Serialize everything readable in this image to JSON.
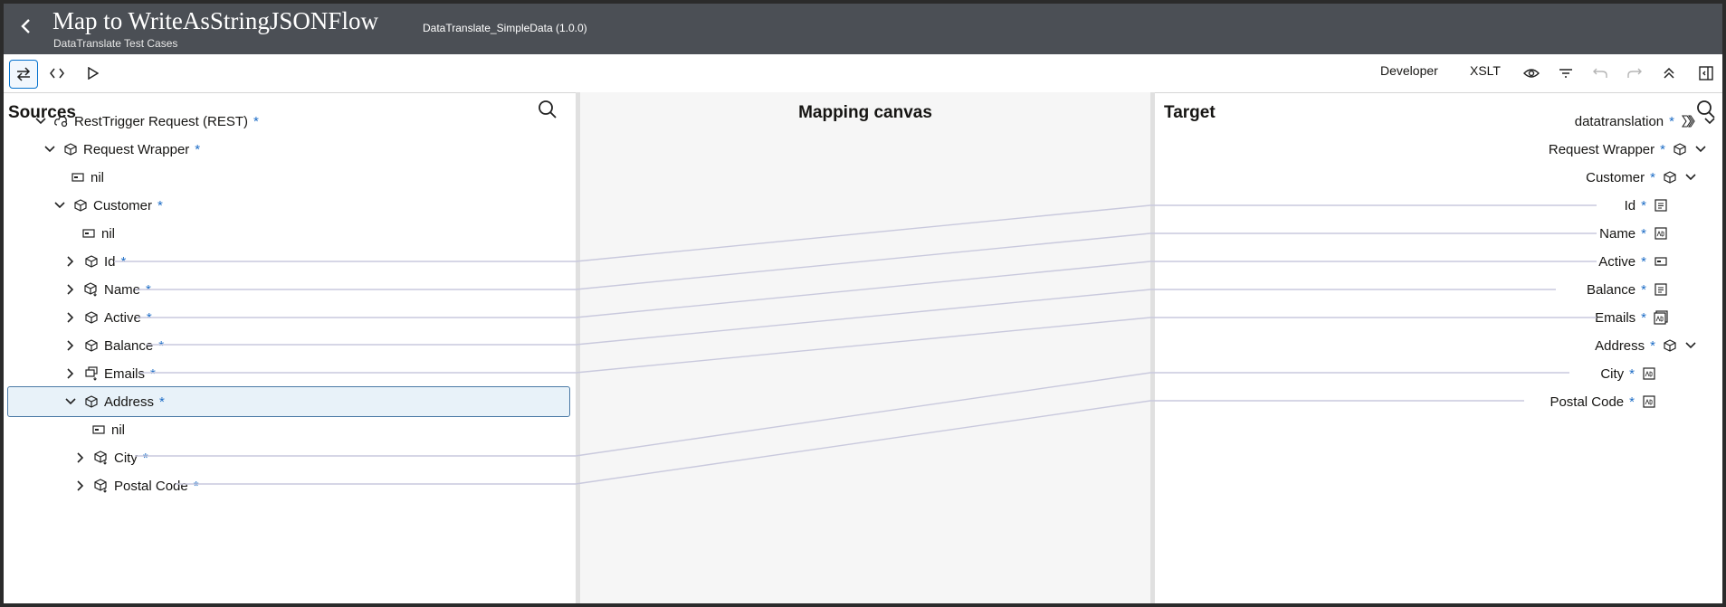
{
  "header": {
    "title": "Map to WriteAsStringJSONFlow",
    "subtitle": "DataTranslate Test Cases",
    "version": "DataTranslate_SimpleData (1.0.0)"
  },
  "toolbar": {
    "mode_label": "Developer",
    "xslt_label": "XSLT"
  },
  "sources": {
    "title": "Sources",
    "rows": {
      "resttrigger": "RestTrigger Request (REST)",
      "request_wrapper": "Request Wrapper",
      "nil1": "nil",
      "customer": "Customer",
      "nil2": "nil",
      "id": "Id",
      "name": "Name",
      "active": "Active",
      "balance": "Balance",
      "emails": "Emails",
      "address": "Address",
      "nil3": "nil",
      "city": "City",
      "postal_code": "Postal Code"
    },
    "required_marker": "*"
  },
  "canvas": {
    "title": "Mapping canvas"
  },
  "target": {
    "title": "Target",
    "rows": {
      "datatranslation": "datatranslation",
      "request_wrapper": "Request Wrapper",
      "customer": "Customer",
      "id": "Id",
      "name": "Name",
      "active": "Active",
      "balance": "Balance",
      "emails": "Emails",
      "address": "Address",
      "city": "City",
      "postal_code": "Postal Code"
    }
  },
  "colors": {
    "header_bg": "#4b4f55",
    "required": "#1c6cc6",
    "mapping_line": "#c9c9dd",
    "selected_row_bg": "#e8f2f9"
  }
}
